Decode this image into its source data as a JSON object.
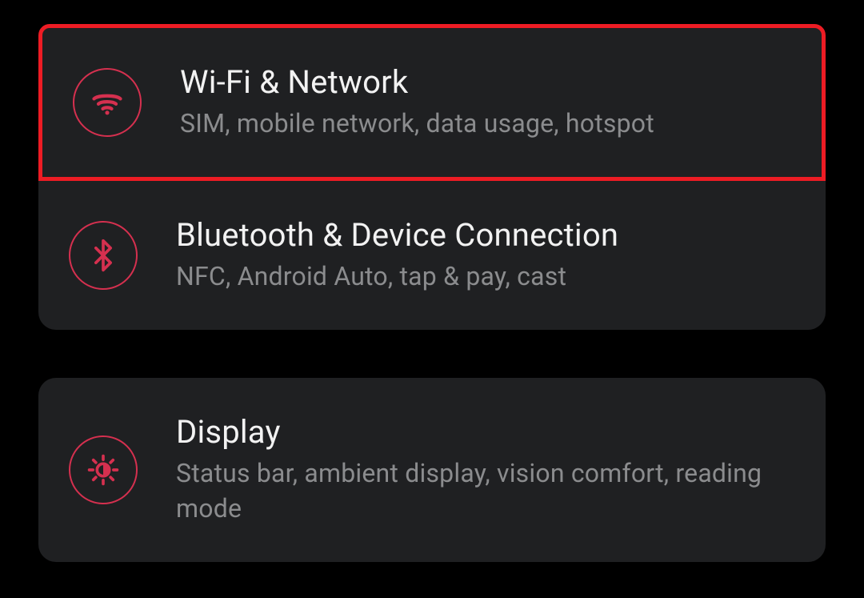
{
  "settings": {
    "group1": {
      "wifi": {
        "title": "Wi-Fi & Network",
        "subtitle": "SIM, mobile network, data usage, hotspot"
      },
      "bluetooth": {
        "title": "Bluetooth & Device Connection",
        "subtitle": "NFC, Android Auto, tap & pay, cast"
      }
    },
    "group2": {
      "display": {
        "title": "Display",
        "subtitle": "Status bar, ambient display, vision comfort, reading mode"
      }
    }
  },
  "colors": {
    "accent": "#d5304f",
    "highlight": "#ed1c24",
    "cardBg": "#1f2022",
    "bg": "#000000",
    "titleText": "#f2f2f2",
    "subtitleText": "#8b8c8e"
  }
}
